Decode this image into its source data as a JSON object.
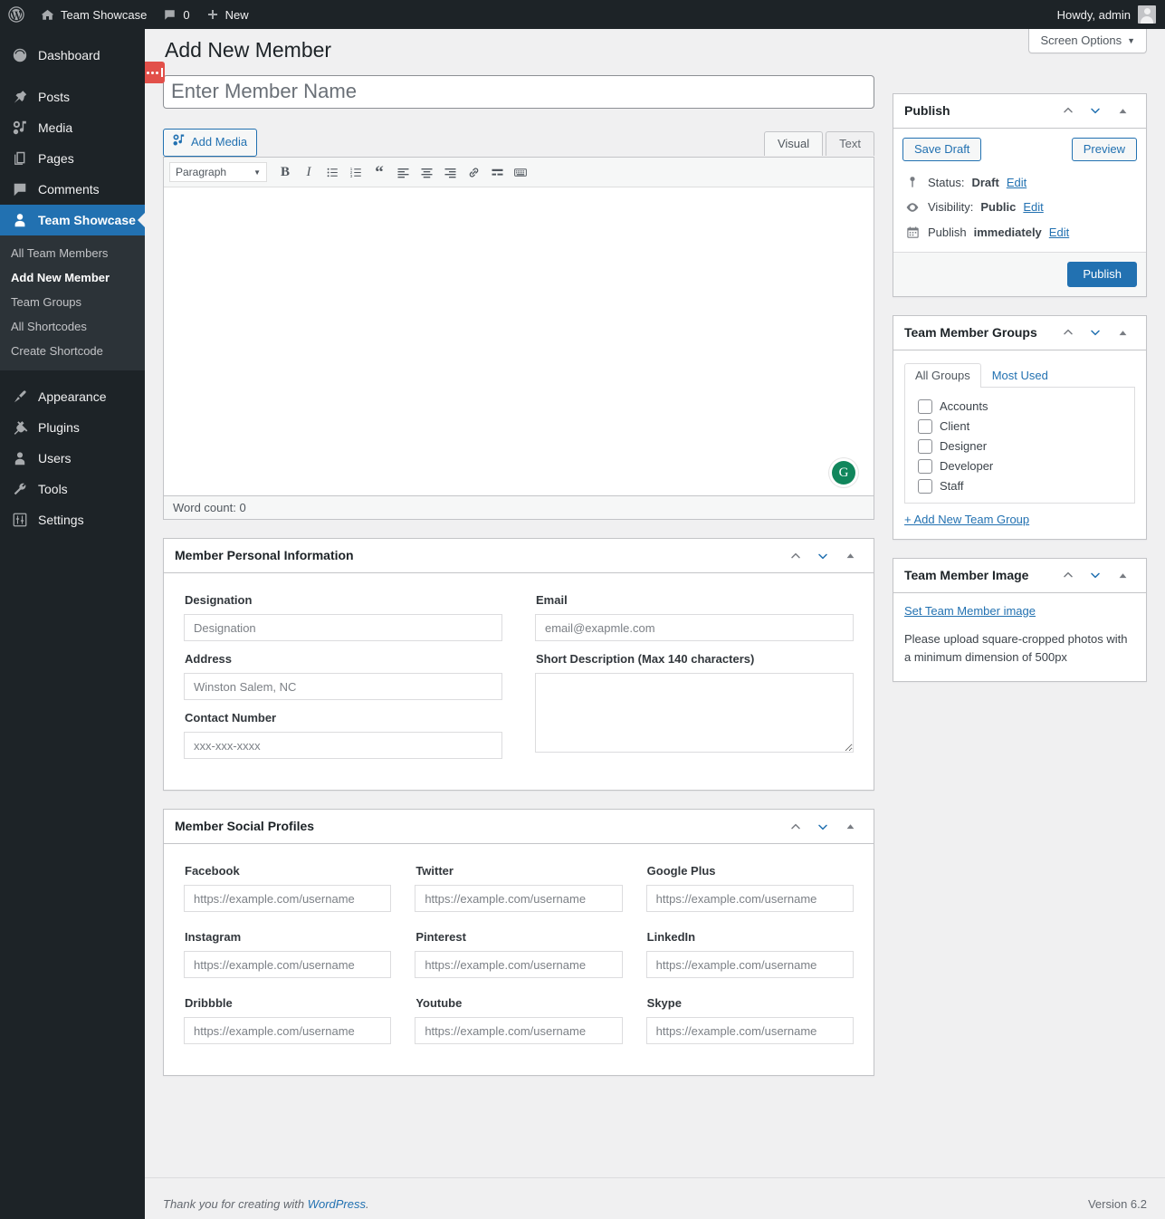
{
  "adminbar": {
    "wp_logo": "wordpress-logo-icon",
    "site_name": "Team Showcase",
    "comments_count": "0",
    "new_label": "New",
    "howdy": "Howdy, admin"
  },
  "screen_meta": {
    "screen_options_label": "Screen Options",
    "caret": "▼"
  },
  "sidebar": {
    "items": [
      {
        "label": "Dashboard",
        "icon": "dashboard-icon",
        "current": false
      },
      {
        "label": "Posts",
        "icon": "pin-icon",
        "current": false
      },
      {
        "label": "Media",
        "icon": "media-icon",
        "current": false
      },
      {
        "label": "Pages",
        "icon": "pages-icon",
        "current": false
      },
      {
        "label": "Comments",
        "icon": "comment-icon",
        "current": false
      },
      {
        "label": "Team Showcase",
        "icon": "user-icon",
        "current": true
      }
    ],
    "submenu": [
      {
        "label": "All Team Members",
        "current": false
      },
      {
        "label": "Add New Member",
        "current": true
      },
      {
        "label": "Team Groups",
        "current": false
      },
      {
        "label": "All Shortcodes",
        "current": false
      },
      {
        "label": "Create Shortcode",
        "current": false
      }
    ],
    "bottom_items": [
      {
        "label": "Appearance",
        "icon": "brush-icon"
      },
      {
        "label": "Plugins",
        "icon": "plug-icon"
      },
      {
        "label": "Users",
        "icon": "users-icon"
      },
      {
        "label": "Tools",
        "icon": "wrench-icon"
      },
      {
        "label": "Settings",
        "icon": "settings-icon"
      }
    ]
  },
  "page": {
    "title": "Add New Member",
    "title_input_placeholder": "Enter Member Name"
  },
  "editor": {
    "add_media_label": "Add Media",
    "tabs": [
      {
        "label": "Visual",
        "active": true
      },
      {
        "label": "Text",
        "active": false
      }
    ],
    "format_select": "Paragraph",
    "select_caret": "▼",
    "toolbar_icons": [
      "bold-icon",
      "italic-icon",
      "bulleted-list-icon",
      "numbered-list-icon",
      "blockquote-icon",
      "align-left-icon",
      "align-center-icon",
      "align-right-icon",
      "link-icon",
      "read-more-icon",
      "keyboard-shortcuts-icon"
    ],
    "grammarly_badge": "G",
    "word_count": "Word count: 0"
  },
  "publish_box": {
    "title": "Publish",
    "save_draft_label": "Save Draft",
    "preview_label": "Preview",
    "status_label": "Status:",
    "status_value": "Draft",
    "status_edit": "Edit",
    "visibility_label": "Visibility:",
    "visibility_value": "Public",
    "visibility_edit": "Edit",
    "publish_label": "Publish",
    "publish_value": "immediately",
    "publish_edit": "Edit",
    "publish_button": "Publish"
  },
  "groups_box": {
    "title": "Team Member Groups",
    "tabs": [
      {
        "label": "All Groups",
        "active": true
      },
      {
        "label": "Most Used",
        "active": false
      }
    ],
    "groups": [
      {
        "label": "Accounts",
        "checked": false
      },
      {
        "label": "Client",
        "checked": false
      },
      {
        "label": "Designer",
        "checked": false
      },
      {
        "label": "Developer",
        "checked": false
      },
      {
        "label": "Staff",
        "checked": false
      }
    ],
    "add_new_link": "+ Add New Team Group"
  },
  "image_box": {
    "title": "Team Member Image",
    "set_image_link": "Set Team Member image",
    "note": "Please upload square-cropped photos with a minimum dimension of 500px"
  },
  "personal_box": {
    "title": "Member Personal Information",
    "fields": [
      {
        "label": "Designation",
        "placeholder": "Designation",
        "type": "text"
      },
      {
        "label": "Email",
        "placeholder": "email@exapmle.com",
        "type": "text"
      },
      {
        "label": "Address",
        "placeholder": "Winston Salem, NC",
        "type": "text"
      },
      {
        "label": "Short Description (Max 140 characters)",
        "placeholder": "",
        "type": "textarea"
      },
      {
        "label": "Contact Number",
        "placeholder": "xxx-xxx-xxxx",
        "type": "text"
      }
    ]
  },
  "social_box": {
    "title": "Member Social Profiles",
    "placeholder": "https://example.com/username",
    "fields": [
      {
        "label": "Facebook"
      },
      {
        "label": "Twitter"
      },
      {
        "label": "Google Plus"
      },
      {
        "label": "Instagram"
      },
      {
        "label": "Pinterest"
      },
      {
        "label": "LinkedIn"
      },
      {
        "label": "Dribbble"
      },
      {
        "label": "Youtube"
      },
      {
        "label": "Skype"
      }
    ]
  },
  "footer": {
    "thanks_prefix": "Thank you for creating with ",
    "wordpress_link": "WordPress",
    "thanks_suffix": ".",
    "version": "Version 6.2"
  },
  "colors": {
    "admin_bar": "#1d2327",
    "menu_current": "#2271b1",
    "accent": "#2271b1",
    "page_bg": "#f0f0f1",
    "red_tab": "#e2504a",
    "grammarly": "#11865c"
  }
}
